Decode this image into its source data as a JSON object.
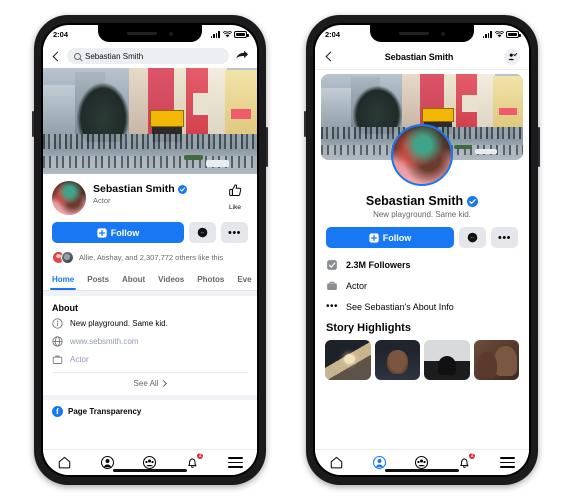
{
  "status_bar": {
    "time": "2:04",
    "signal_icon": "cellular-bars-icon",
    "wifi_icon": "wifi-icon",
    "battery_icon": "battery-icon"
  },
  "left_phone": {
    "search": {
      "value": "Sebastian Smith",
      "placeholder": "Search",
      "search_icon": "search-icon",
      "back_icon": "chevron-left-icon",
      "share_icon": "share-arrow-icon"
    },
    "cover_photo_alt": "city-street-crossing-cover-photo",
    "profile": {
      "name": "Sebastian Smith",
      "verified_icon": "verified-badge-icon",
      "subtitle": "Actor",
      "avatar_alt": "profile-avatar",
      "like_label": "Like",
      "like_icon": "thumbs-up-icon"
    },
    "actions": {
      "follow_label": "Follow",
      "follow_icon": "follow-plus-icon",
      "message_icon": "messenger-icon",
      "more_icon": "more-dots-icon"
    },
    "social_proof": {
      "text": "Allie, Atishay, and 2,307,772 others like this"
    },
    "tabs": [
      {
        "label": "Home",
        "active": true
      },
      {
        "label": "Posts",
        "active": false
      },
      {
        "label": "About",
        "active": false
      },
      {
        "label": "Videos",
        "active": false
      },
      {
        "label": "Photos",
        "active": false
      },
      {
        "label": "Eve",
        "active": false
      }
    ],
    "about": {
      "title": "About",
      "rows": [
        {
          "icon": "info-circle-icon",
          "text": "New playground. Same kid.",
          "style": "normal"
        },
        {
          "icon": "globe-icon",
          "text": "www.sebsmith.com",
          "style": "link"
        },
        {
          "icon": "briefcase-icon",
          "text": "Actor",
          "style": "muted"
        }
      ],
      "see_all_label": "See All",
      "see_all_icon": "chevron-right-icon"
    },
    "page_transparency": {
      "label": "Page Transparency",
      "icon": "facebook-logo-icon"
    },
    "tabbar": [
      {
        "name": "home",
        "icon": "home-icon",
        "active": false,
        "badge": ""
      },
      {
        "name": "profile",
        "icon": "profile-circle-icon",
        "active": false,
        "badge": ""
      },
      {
        "name": "groups",
        "icon": "groups-icon",
        "active": false,
        "badge": ""
      },
      {
        "name": "notifications",
        "icon": "bell-icon",
        "active": false,
        "badge": "2"
      },
      {
        "name": "menu",
        "icon": "hamburger-menu-icon",
        "active": false,
        "badge": ""
      }
    ]
  },
  "right_phone": {
    "header": {
      "title": "Sebastian Smith",
      "back_icon": "chevron-left-icon",
      "action_icon": "add-friend-icon"
    },
    "cover_photo_alt": "city-street-crossing-cover-photo",
    "profile": {
      "name": "Sebastian Smith",
      "verified_icon": "verified-badge-icon",
      "bio": "New playground. Same kid.",
      "avatar_alt": "profile-avatar-ringed"
    },
    "actions": {
      "follow_label": "Follow",
      "follow_icon": "follow-plus-icon",
      "message_icon": "messenger-icon",
      "more_icon": "more-dots-icon"
    },
    "stats": [
      {
        "icon": "followers-icon",
        "text": "2.3M Followers",
        "bold": true
      },
      {
        "icon": "briefcase-icon",
        "text": "Actor",
        "bold": false
      },
      {
        "icon": "more-dots-icon",
        "text": "See Sebastian's About Info",
        "bold": false
      }
    ],
    "story_highlights": {
      "title": "Story Highlights",
      "items": [
        {
          "alt": "story-lamp-interior"
        },
        {
          "alt": "story-portrait-woman"
        },
        {
          "alt": "story-silhouette-bw"
        },
        {
          "alt": "story-two-people-selfie"
        }
      ]
    },
    "tabbar": [
      {
        "name": "home",
        "icon": "home-icon",
        "active": false,
        "badge": ""
      },
      {
        "name": "profile",
        "icon": "profile-circle-icon",
        "active": true,
        "badge": ""
      },
      {
        "name": "groups",
        "icon": "groups-icon",
        "active": false,
        "badge": ""
      },
      {
        "name": "notifications",
        "icon": "bell-icon",
        "active": false,
        "badge": "2"
      },
      {
        "name": "menu",
        "icon": "hamburger-menu-icon",
        "active": false,
        "badge": ""
      }
    ]
  },
  "colors": {
    "accent": "#1877f2",
    "badge": "#e41e3f",
    "chip": "#e4e6eb",
    "muted": "#65676b"
  }
}
